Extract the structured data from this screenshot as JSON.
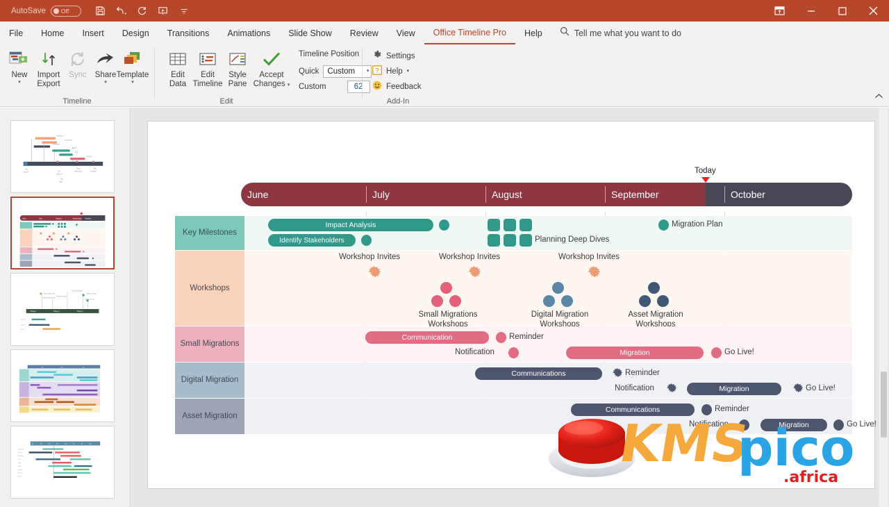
{
  "titlebar": {
    "autosave_label": "AutoSave",
    "autosave_state": "Off",
    "quick_access": [
      "save-icon",
      "undo-icon",
      "redo-icon",
      "present-icon",
      "more-icon"
    ],
    "window_buttons": [
      "ribbon-display-options-icon",
      "minimize-icon",
      "maximize-icon",
      "close-icon"
    ],
    "accent_color": "#b7472a"
  },
  "tabs": [
    {
      "label": "File",
      "active": false
    },
    {
      "label": "Home",
      "active": false
    },
    {
      "label": "Insert",
      "active": false
    },
    {
      "label": "Design",
      "active": false
    },
    {
      "label": "Transitions",
      "active": false
    },
    {
      "label": "Animations",
      "active": false
    },
    {
      "label": "Slide Show",
      "active": false
    },
    {
      "label": "Review",
      "active": false
    },
    {
      "label": "View",
      "active": false
    },
    {
      "label": "Office Timeline Pro",
      "active": true
    },
    {
      "label": "Help",
      "active": false
    }
  ],
  "tellme": {
    "text": "Tell me what you want to do",
    "icon": "search-icon"
  },
  "ribbon": {
    "groups": [
      {
        "name": "Timeline",
        "label": "Timeline",
        "buttons": [
          {
            "label1": "New",
            "label2": "",
            "icon": "new-timeline-icon",
            "dropdown": true,
            "disabled": false
          },
          {
            "label1": "Import",
            "label2": "Export",
            "icon": "import-export-icon",
            "dropdown": true,
            "disabled": false
          },
          {
            "label1": "Sync",
            "label2": "",
            "icon": "sync-icon",
            "dropdown": false,
            "disabled": true
          },
          {
            "label1": "Share",
            "label2": "",
            "icon": "share-icon",
            "dropdown": true,
            "disabled": false
          },
          {
            "label1": "Template",
            "label2": "",
            "icon": "template-icon",
            "dropdown": true,
            "disabled": false
          }
        ]
      },
      {
        "name": "Edit",
        "label": "Edit",
        "buttons": [
          {
            "label1": "Edit",
            "label2": "Data",
            "icon": "edit-data-icon",
            "dropdown": false,
            "disabled": false
          },
          {
            "label1": "Edit",
            "label2": "Timeline",
            "icon": "edit-timeline-icon",
            "dropdown": false,
            "disabled": false
          },
          {
            "label1": "Style",
            "label2": "Pane",
            "icon": "style-pane-icon",
            "dropdown": false,
            "disabled": false
          },
          {
            "label1": "Accept",
            "label2": "Changes",
            "icon": "accept-changes-icon",
            "dropdown": true,
            "disabled": false
          }
        ],
        "position_title": "Timeline Position",
        "quick_label": "Quick",
        "quick_value": "Custom",
        "custom_label": "Custom",
        "custom_value": "62"
      },
      {
        "name": "Add-In",
        "label": "Add-In",
        "items": [
          {
            "label": "Settings",
            "icon": "gear-icon",
            "dropdown": false
          },
          {
            "label": "Help",
            "icon": "help-icon",
            "dropdown": true
          },
          {
            "label": "Feedback",
            "icon": "feedback-icon",
            "dropdown": false
          }
        ]
      }
    ],
    "collapse_icon": "chevron-up-icon"
  },
  "thumbnails": [
    {
      "index": 1,
      "selected": false
    },
    {
      "index": 2,
      "selected": true
    },
    {
      "index": 3,
      "selected": false
    },
    {
      "index": 4,
      "selected": false
    },
    {
      "index": 5,
      "selected": false
    }
  ],
  "chart_data": {
    "type": "timeline",
    "title": "",
    "today": {
      "label": "Today",
      "x_pct": 76.0
    },
    "timeband": {
      "months": [
        "June",
        "July",
        "August",
        "September",
        "October"
      ],
      "month_x_pct": [
        0.0,
        20.5,
        40.1,
        59.7,
        78.0
      ],
      "past_color": "#8e3740",
      "future_color": "#464655"
    },
    "swimlanes": [
      {
        "name": "Key Milestones",
        "label_color": "#7ec8b8",
        "band_color": "#f0f8f6",
        "accent_color": "#31998a",
        "items": [
          {
            "type": "bar",
            "label": "Impact Analysis",
            "start_pct": 2.8,
            "end_pct": 29.8,
            "row": 0
          },
          {
            "type": "dot",
            "label": "",
            "x_pct": 32.0,
            "row": 0
          },
          {
            "type": "square",
            "label": "",
            "x_pct": 39.6,
            "row": 0
          },
          {
            "type": "square",
            "label": "",
            "x_pct": 42.2,
            "row": 0
          },
          {
            "type": "square",
            "label": "",
            "x_pct": 44.8,
            "row": 0
          },
          {
            "type": "dot",
            "label": "Migration Plan",
            "x_pct": 67.6,
            "row": 0
          },
          {
            "type": "bar",
            "label": "Identify Stakeholders",
            "start_pct": 2.8,
            "end_pct": 14.2,
            "row": 1
          },
          {
            "type": "dot",
            "label": "",
            "x_pct": 18.8,
            "row": 1
          },
          {
            "type": "square",
            "label": "",
            "x_pct": 39.6,
            "row": 1
          },
          {
            "type": "square",
            "label": "",
            "x_pct": 42.2,
            "row": 1
          },
          {
            "type": "square",
            "label": "Planning Deep Dives",
            "x_pct": 44.8,
            "row": 1
          }
        ]
      },
      {
        "name": "Workshops",
        "label_color": "#fad3bd",
        "band_color": "#fdf6f1",
        "accent_color": "#ed9b72",
        "groups": [
          {
            "invite_label": "Workshop Invites",
            "invite_x_pct": 28.4
          },
          {
            "invite_label": "Workshop Invites",
            "invite_x_pct": 44.6
          },
          {
            "invite_label": "Workshop Invites",
            "invite_x_pct": 62.1
          }
        ],
        "clusters": [
          {
            "label": "Small Migrations Workshops",
            "x_pct": 38.8,
            "color": "#e26178"
          },
          {
            "label": "Digital Migration Workshops",
            "x_pct": 55.4,
            "color": "#5b87a5"
          },
          {
            "label": "Asset Migration Workshops",
            "x_pct": 69.5,
            "color": "#3f5876"
          }
        ]
      },
      {
        "name": "Small Migrations",
        "label_color": "#eeb0bd",
        "band_color": "#fdf2f4",
        "accent_color": "#e26c81",
        "items": [
          {
            "type": "bar",
            "label": "Communication",
            "start_pct": 20.4,
            "end_pct": 38.5,
            "row": 0
          },
          {
            "type": "dot",
            "label": "Reminder",
            "x_pct": 41.0,
            "row": 0,
            "label_side": "right"
          },
          {
            "type": "dot",
            "label": "Notification",
            "x_pct": 45.3,
            "row": 1,
            "label_side": "left"
          },
          {
            "type": "bar",
            "label": "Migration",
            "start_pct": 51.8,
            "end_pct": 74.2,
            "row": 1
          },
          {
            "type": "dot",
            "label": "Go Live!",
            "x_pct": 77.3,
            "row": 1,
            "label_side": "right"
          }
        ]
      },
      {
        "name": "Digital Migration",
        "label_color": "#a9bccb",
        "band_color": "#f0f2f5",
        "accent_color": "#4d566d",
        "items": [
          {
            "type": "bar",
            "label": "Communications",
            "start_pct": 38.9,
            "end_pct": 60.1,
            "row": 0
          },
          {
            "type": "star",
            "label": "Reminder",
            "x_pct": 62.8,
            "row": 0,
            "label_side": "right"
          },
          {
            "type": "star",
            "label": "Notification",
            "x_pct": 68.4,
            "row": 1,
            "label_side": "left"
          },
          {
            "type": "bar",
            "label": "Migration",
            "start_pct": 71.3,
            "end_pct": 86.7,
            "row": 1
          },
          {
            "type": "star",
            "label": "Go Live!",
            "x_pct": 89.8,
            "row": 1,
            "label_side": "right"
          }
        ]
      },
      {
        "name": "Asset Migration",
        "label_color": "#9fa4b5",
        "band_color": "#eef0f3",
        "accent_color": "#4d566d",
        "items": [
          {
            "type": "bar",
            "label": "Communications",
            "start_pct": 53.4,
            "end_pct": 74.0,
            "row": 0
          },
          {
            "type": "dot",
            "label": "Reminder",
            "x_pct": 76.5,
            "row": 0,
            "label_side": "right"
          },
          {
            "type": "dot",
            "label": "Notification",
            "x_pct": 81.0,
            "row": 1,
            "label_side": "left"
          },
          {
            "type": "bar",
            "label": "Migration",
            "start_pct": 84.0,
            "end_pct": 94.0,
            "row": 1
          },
          {
            "type": "dot",
            "label": "Go Live!",
            "x_pct": 96.0,
            "row": 1,
            "label_side": "right"
          }
        ]
      }
    ]
  },
  "watermark": {
    "text_kms": "KMS",
    "text_pico": "pico",
    "text_africa": ".africa",
    "kms_color": "#f5a83c",
    "pico_color": "#2aa4e5",
    "africa_color": "#e02020",
    "button_color": "#e32119"
  }
}
